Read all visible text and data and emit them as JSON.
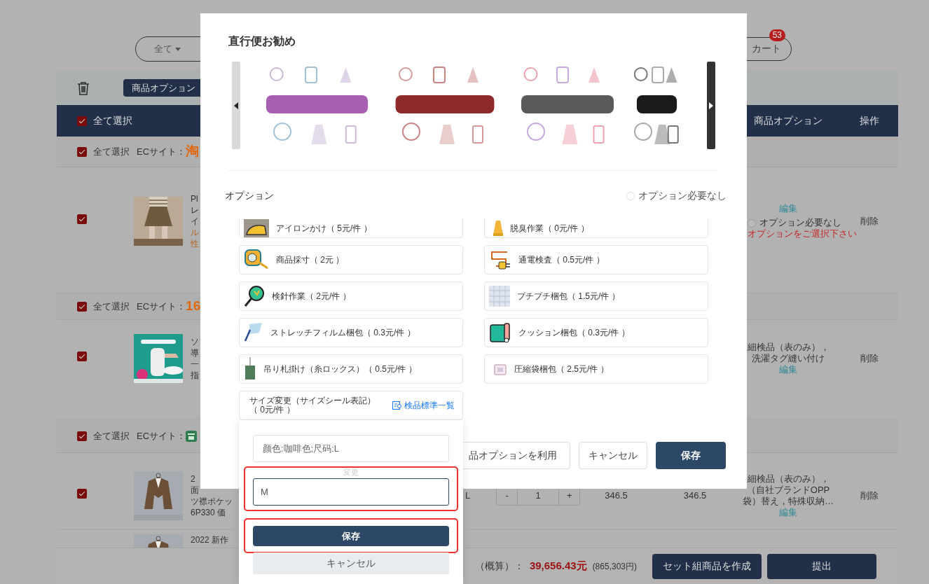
{
  "top_bar": {
    "filter": "全て",
    "cart": "カート",
    "cart_badge": "53"
  },
  "toolbar": {
    "option_button": "商品オプション"
  },
  "table_header": {
    "select_all": "全て選択",
    "checked": true,
    "columns": [
      "商品オプション",
      "操作"
    ]
  },
  "groups": [
    {
      "select_all": "全て選択",
      "checked": true,
      "site_label": "ECサイト：",
      "site_logo": "淘",
      "kind": "text",
      "products": [
        {
          "checked": true,
          "title_lines": [
            "Pl",
            "レ",
            "イ"
          ],
          "accent_lines": [
            "ル",
            "性"
          ],
          "edit": "編集",
          "no_option": {
            "label": "オプション必要なし",
            "selected": false
          },
          "warning": "オプションをご選択下さい",
          "delete": "削除"
        }
      ]
    },
    {
      "select_all": "全て選択",
      "checked": true,
      "site_label": "ECサイト：",
      "site_logo": "16",
      "kind": "text",
      "products": [
        {
          "checked": true,
          "title_lines": [
            "ソ",
            "導",
            "一",
            "指"
          ],
          "option_lines": [
            "細検品（表のみ），",
            "洗濯タグ縫い付け"
          ],
          "edit": "編集",
          "delete": "削除"
        }
      ]
    },
    {
      "select_all": "全て選択",
      "checked": true,
      "site_label": "ECサイト：",
      "kind": "icon",
      "products": [
        {
          "checked": true,
          "title_lines": [
            "2",
            "面",
            "ツ襟ポケッ",
            "6P330 価"
          ],
          "variant": "L",
          "minus": "-",
          "quantity": "1",
          "plus": "+",
          "unit_price": "346.5",
          "subtotal": "346.5",
          "option_lines": [
            "細検品（表のみ），",
            "（自社ブランドOPP",
            "袋）替え，特殊収納…"
          ],
          "edit": "編集",
          "delete": "削除"
        },
        {
          "title_lines": [
            "2022 新作"
          ]
        }
      ]
    }
  ],
  "footer": {
    "total_label": "（概算）：",
    "total": "39,656.43元",
    "total_jpy": "(865,303円)",
    "buttons": [
      "セット組商品を作成",
      "提出"
    ]
  },
  "modal": {
    "title": "直行便お勧め",
    "options_title": "オプション",
    "no_option": {
      "label": "オプション必要なし",
      "selected": false
    },
    "options": [
      {
        "label": "アイロンかけ（ 5元/件 ）"
      },
      {
        "label": "脱臭作業（ 0元/件 ）"
      },
      {
        "label": "商品採寸（ 2元 ）"
      },
      {
        "label": "通電検査（ 0.5元/件 ）"
      },
      {
        "label": "検針作業（ 2元/件 ）"
      },
      {
        "label": "プチプチ梱包（ 1.5元/件 ）"
      },
      {
        "label": "ストレッチフィルム梱包（ 0.3元/件 ）"
      },
      {
        "label": "クッション梱包（ 0.3元/件 ）"
      },
      {
        "label": "吊り札掛け（糸ロックス）（ 0.5元/件 ）"
      },
      {
        "label": "圧縮袋梱包（ 2.5元/件 ）"
      }
    ],
    "size_option": {
      "label": "サイズ変更（サイズシール表記）（ 0元/件 ）",
      "link": "検品標準一覧"
    },
    "buttons": [
      {
        "label": "品オプションを利用",
        "kind": "outline"
      },
      {
        "label": "キャンセル",
        "kind": "outline"
      },
      {
        "label": "保存",
        "kind": "primary"
      }
    ]
  },
  "size_popover": {
    "current": "颜色:咖啡色;尺码:L",
    "change_label": "変更",
    "new_value": "M",
    "highlighted": true,
    "save": "保存",
    "cancel": "キャンセル"
  }
}
